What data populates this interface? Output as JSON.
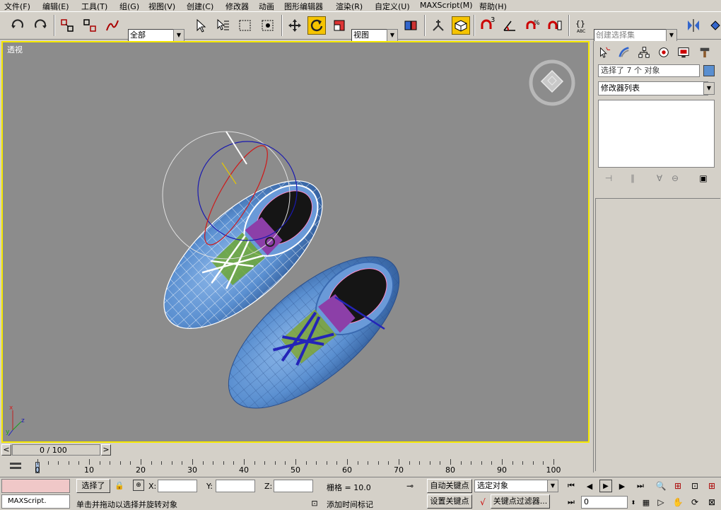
{
  "menubar": {
    "items": [
      "文件(F)",
      "编辑(E)",
      "工具(T)",
      "组(G)",
      "视图(V)",
      "创建(C)",
      "修改器",
      "动画",
      "图形编辑器",
      "渲染(R)",
      "自定义(U)",
      "MAXScript(M)",
      "帮助(H)"
    ]
  },
  "toolbar": {
    "selection_filter": "全部",
    "reference_coord": "视图",
    "named_selection_placeholder": "创建选择集",
    "snap_angle_label": "3"
  },
  "viewport": {
    "label": "透视",
    "axis_x": "x",
    "axis_y": "y",
    "axis_z": "z"
  },
  "command_panel": {
    "selection_info": "选择了 7 个 对象",
    "modifier_list": "修改器列表"
  },
  "timeline": {
    "frame_indicator": "0 / 100",
    "ticks": [
      "0",
      "10",
      "20",
      "30",
      "40",
      "50",
      "60",
      "70",
      "80",
      "90",
      "100"
    ]
  },
  "status": {
    "maxscript_label": "MAXScript.",
    "selection_status": "选择了",
    "x_label": "X:",
    "y_label": "Y:",
    "z_label": "Z:",
    "grid_label": "栅格 = 10.0",
    "prompt": "单击并拖动以选择并旋转对象",
    "add_time_tag": "添加时间标记",
    "auto_key": "自动关键点",
    "set_key": "设置关键点",
    "key_mode": "选定对象",
    "key_filters": "关键点过滤器...",
    "current_frame": "0"
  },
  "colors": {
    "viewport_bg": "#8c8c8c",
    "active_border": "#f5e800",
    "panel_bg": "#d4d0c8",
    "object_color": "#5a8fd0"
  }
}
